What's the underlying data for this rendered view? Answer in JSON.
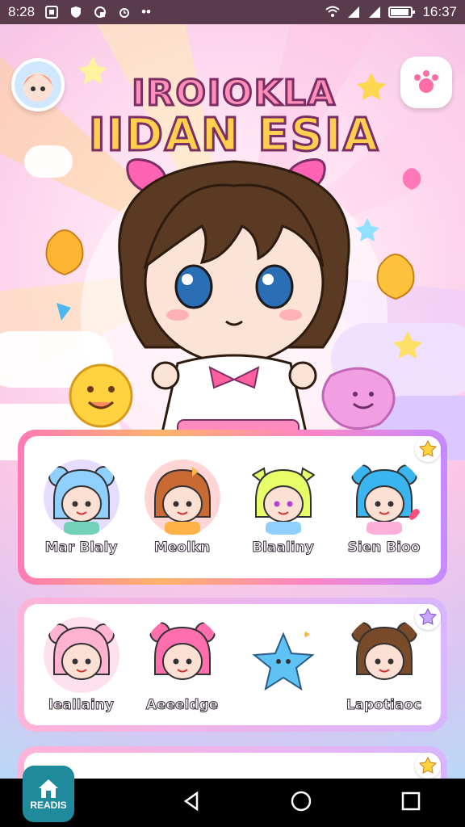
{
  "status_bar": {
    "time_left": "8:28",
    "time_right": "16:37",
    "more": "••"
  },
  "app": {
    "title_line1": "IROIOKLA",
    "title_line2": "IIDAN ESIA"
  },
  "cards": {
    "row1": [
      {
        "name": "Mar Blaly",
        "hair": "#8fd0ff",
        "skin": "#fde0d4",
        "bg": "#e6dcff"
      },
      {
        "name": "Meolkn",
        "hair": "#c96a33",
        "skin": "#fde0d4",
        "bg": "#ffd5d5"
      },
      {
        "name": "Blaaliny",
        "hair": "#e9ff6a",
        "skin": "#fde0d4",
        "bg": "#ffffff"
      },
      {
        "name": "Sien Bioo",
        "hair": "#39b6f0",
        "skin": "#fde0d4",
        "bg": "#ffffff"
      }
    ],
    "row2": [
      {
        "name": "leallainy",
        "hair": "#ffb3d1",
        "skin": "#fde0d4",
        "bg": "#ffe0ef"
      },
      {
        "name": "Aeeeldge",
        "hair": "#ff6fae",
        "skin": "#fde0d4",
        "bg": "#ffffff"
      },
      {
        "name": "",
        "hair": "#5fc2f5",
        "skin": "#5fc2f5",
        "bg": "#ffffff"
      },
      {
        "name": "Lapotiaoc",
        "hair": "#7a4b2a",
        "skin": "#fde0d4",
        "bg": "#ffffff"
      }
    ]
  },
  "nav": {
    "home_label": "READIS"
  },
  "colors": {
    "status_bar": "#5a3b4b",
    "accent_pink": "#ff7ab6",
    "accent_teal": "#1f8a9c"
  }
}
